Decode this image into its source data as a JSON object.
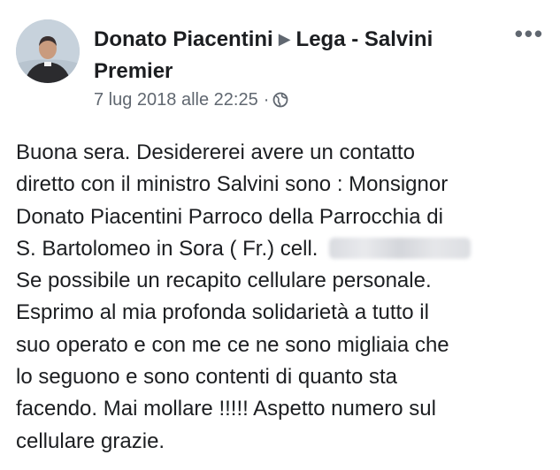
{
  "post": {
    "author": "Donato Piacentini",
    "arrow": "▶",
    "group": "Lega - Salvini Premier",
    "timestamp": "7 lug 2018 alle 22:25",
    "meta_separator": "·",
    "privacy_icon": "globe-icon",
    "more_icon": "more-options-icon",
    "more_label": "•••",
    "body_lines": [
      "Buona sera. Desidererei avere un contatto",
      "diretto con il ministro Salvini sono : Monsignor",
      "Donato Piacentini Parroco della Parrocchia di",
      "S. Bartolomeo in Sora ( Fr.) cell. ",
      "Se possibile un recapito cellulare personale.",
      "Esprimo al mia profonda solidarietà a tutto il",
      "suo operato e con me ce ne sono migliaia che",
      "lo seguono e sono contenti di quanto sta",
      "facendo. Mai mollare !!!!!  Aspetto numero sul",
      "cellulare grazie."
    ]
  },
  "colors": {
    "text": "#1c1e21",
    "secondary": "#606770",
    "background": "#ffffff"
  }
}
